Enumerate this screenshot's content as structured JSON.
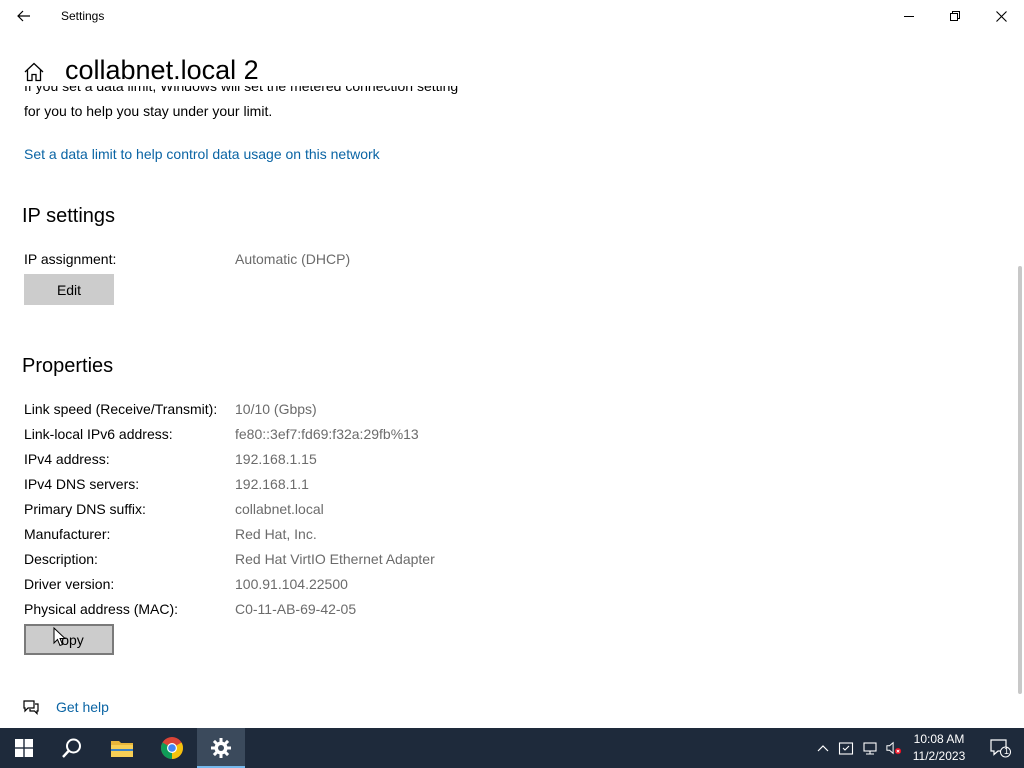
{
  "window": {
    "title": "Settings"
  },
  "page": {
    "title": "collabnet.local 2",
    "clipped_text": "If you set a data limit, Windows will set the metered connection setting",
    "info_line": "for you to help you stay under your limit.",
    "data_limit_link": "Set a data limit to help control data usage on this network"
  },
  "ip_settings": {
    "heading": "IP settings",
    "assignment_label": "IP assignment:",
    "assignment_value": "Automatic (DHCP)",
    "edit_button": "Edit"
  },
  "properties": {
    "heading": "Properties",
    "rows": [
      {
        "label": "Link speed (Receive/Transmit):",
        "value": "10/10 (Gbps)"
      },
      {
        "label": "Link-local IPv6 address:",
        "value": "fe80::3ef7:fd69:f32a:29fb%13"
      },
      {
        "label": "IPv4 address:",
        "value": "192.168.1.15"
      },
      {
        "label": "IPv4 DNS servers:",
        "value": "192.168.1.1"
      },
      {
        "label": "Primary DNS suffix:",
        "value": "collabnet.local"
      },
      {
        "label": "Manufacturer:",
        "value": "Red Hat, Inc."
      },
      {
        "label": "Description:",
        "value": "Red Hat VirtIO Ethernet Adapter"
      },
      {
        "label": "Driver version:",
        "value": "100.91.104.22500"
      },
      {
        "label": "Physical address (MAC):",
        "value": "C0-11-AB-69-42-05"
      }
    ],
    "copy_button": "opy"
  },
  "help": {
    "link": "Get help"
  },
  "taskbar": {
    "time": "10:08 AM",
    "date": "11/2/2023",
    "notification_count": "1"
  },
  "colors": {
    "link": "#0a64a4",
    "value_text": "#6b6b6b",
    "taskbar": "#1e2a3b",
    "button": "#cccccc"
  }
}
